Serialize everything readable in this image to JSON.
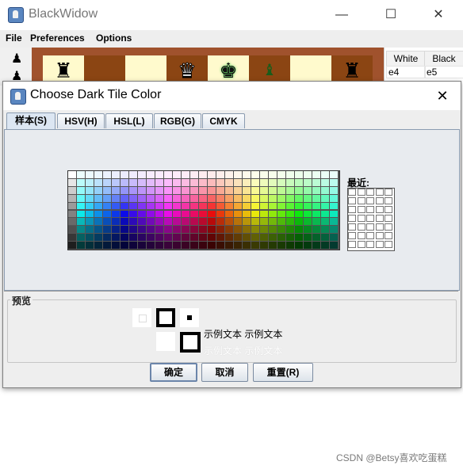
{
  "app": {
    "title": "BlackWidow"
  },
  "window_controls": {
    "minimize": "—",
    "maximize": "☐",
    "close": "✕"
  },
  "menubar": [
    {
      "label": "File"
    },
    {
      "label": "Preferences"
    },
    {
      "label": "Options"
    }
  ],
  "board_pieces": [
    "♜",
    "♛",
    "♚",
    "♝",
    "♜"
  ],
  "moves": {
    "headers": [
      "White",
      "Black"
    ],
    "rows": [
      [
        "e4",
        "e5"
      ]
    ]
  },
  "dialog": {
    "title": "Choose Dark Tile Color",
    "close": "✕",
    "tabs": [
      "样本(S)",
      "HSV(H)",
      "HSL(L)",
      "RGB(G)",
      "CMYK"
    ],
    "recent_label": "最近:",
    "preview_label": "预览",
    "sample_text": "示例文本  示例文本",
    "buttons": {
      "ok": "确定",
      "cancel": "取消",
      "reset": "重置(R)"
    }
  },
  "watermark": "CSDN @Betsy喜欢吃蛋糕"
}
